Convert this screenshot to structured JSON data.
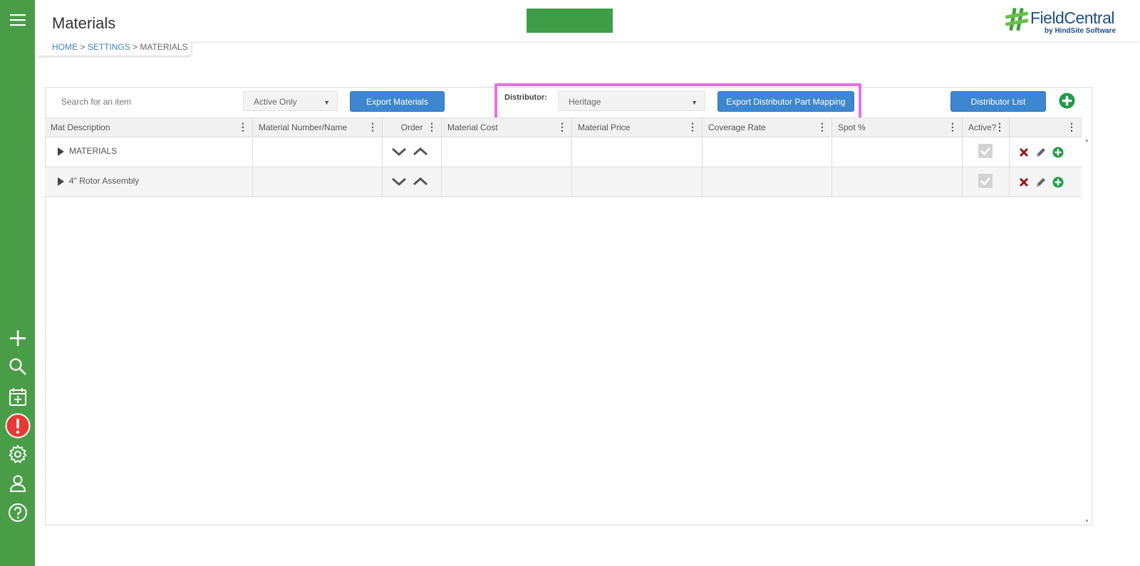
{
  "header": {
    "title": "Materials",
    "logo_text": "FieldCentral",
    "logo_sub": "by HindSite Software"
  },
  "breadcrumb": {
    "home": "HOME",
    "settings": "SETTINGS",
    "current": "MATERIALS",
    "sep": " > "
  },
  "toolbar": {
    "search_placeholder": "Search for an item",
    "filter_value": "Active Only",
    "export_materials": "Export Materials",
    "distributor_label": "Distributor:",
    "distributor_value": "Heritage",
    "export_mapping": "Export Distributor Part Mapping",
    "distributor_list": "Distributor List"
  },
  "table": {
    "columns": [
      "Mat Description",
      "Material Number/Name",
      "Order",
      "Material Cost",
      "Material Price",
      "Coverage Rate",
      "Spot %",
      "Active?",
      ""
    ],
    "rows": [
      {
        "description": "MATERIALS",
        "active": true
      },
      {
        "description": "4\" Rotor Assembly",
        "active": true
      }
    ]
  },
  "colors": {
    "sidebar": "#4a9d47",
    "button": "#3d87d0",
    "highlight": "#e371e6",
    "add": "#1e9b45",
    "delete": "#a01010"
  },
  "icons": {
    "sidebar": [
      "menu-icon",
      "plus-icon",
      "search-icon",
      "calendar-add-icon",
      "alert-icon",
      "gear-icon",
      "user-icon",
      "help-icon"
    ]
  }
}
